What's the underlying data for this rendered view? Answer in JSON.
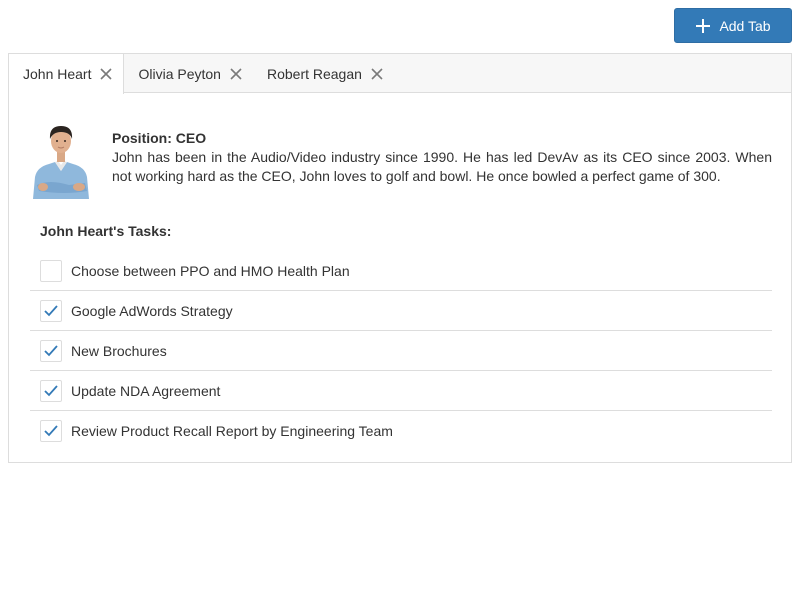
{
  "toolbar": {
    "add_tab_label": "Add Tab"
  },
  "tabs": [
    {
      "label": "John Heart",
      "active": true
    },
    {
      "label": "Olivia Peyton",
      "active": false
    },
    {
      "label": "Robert Reagan",
      "active": false
    }
  ],
  "employee": {
    "position_line": "Position: CEO",
    "bio": "John has been in the Audio/Video industry since 1990. He has led DevAv as its CEO since 2003. When not working hard as the CEO, John loves to golf and bowl. He once bowled a perfect game of 300.",
    "tasks_heading": "John Heart's Tasks:",
    "tasks": [
      {
        "text": "Choose between PPO and HMO Health Plan",
        "checked": false
      },
      {
        "text": "Google AdWords Strategy",
        "checked": true
      },
      {
        "text": "New Brochures",
        "checked": true
      },
      {
        "text": "Update NDA Agreement",
        "checked": true
      },
      {
        "text": "Review Product Recall Report by Engineering Team",
        "checked": true
      }
    ]
  },
  "icons": {
    "add": "plus-icon",
    "close": "close-icon",
    "check": "check-icon"
  },
  "colors": {
    "accent": "#337ab7",
    "check": "#337ab7",
    "border": "#dddddd"
  }
}
